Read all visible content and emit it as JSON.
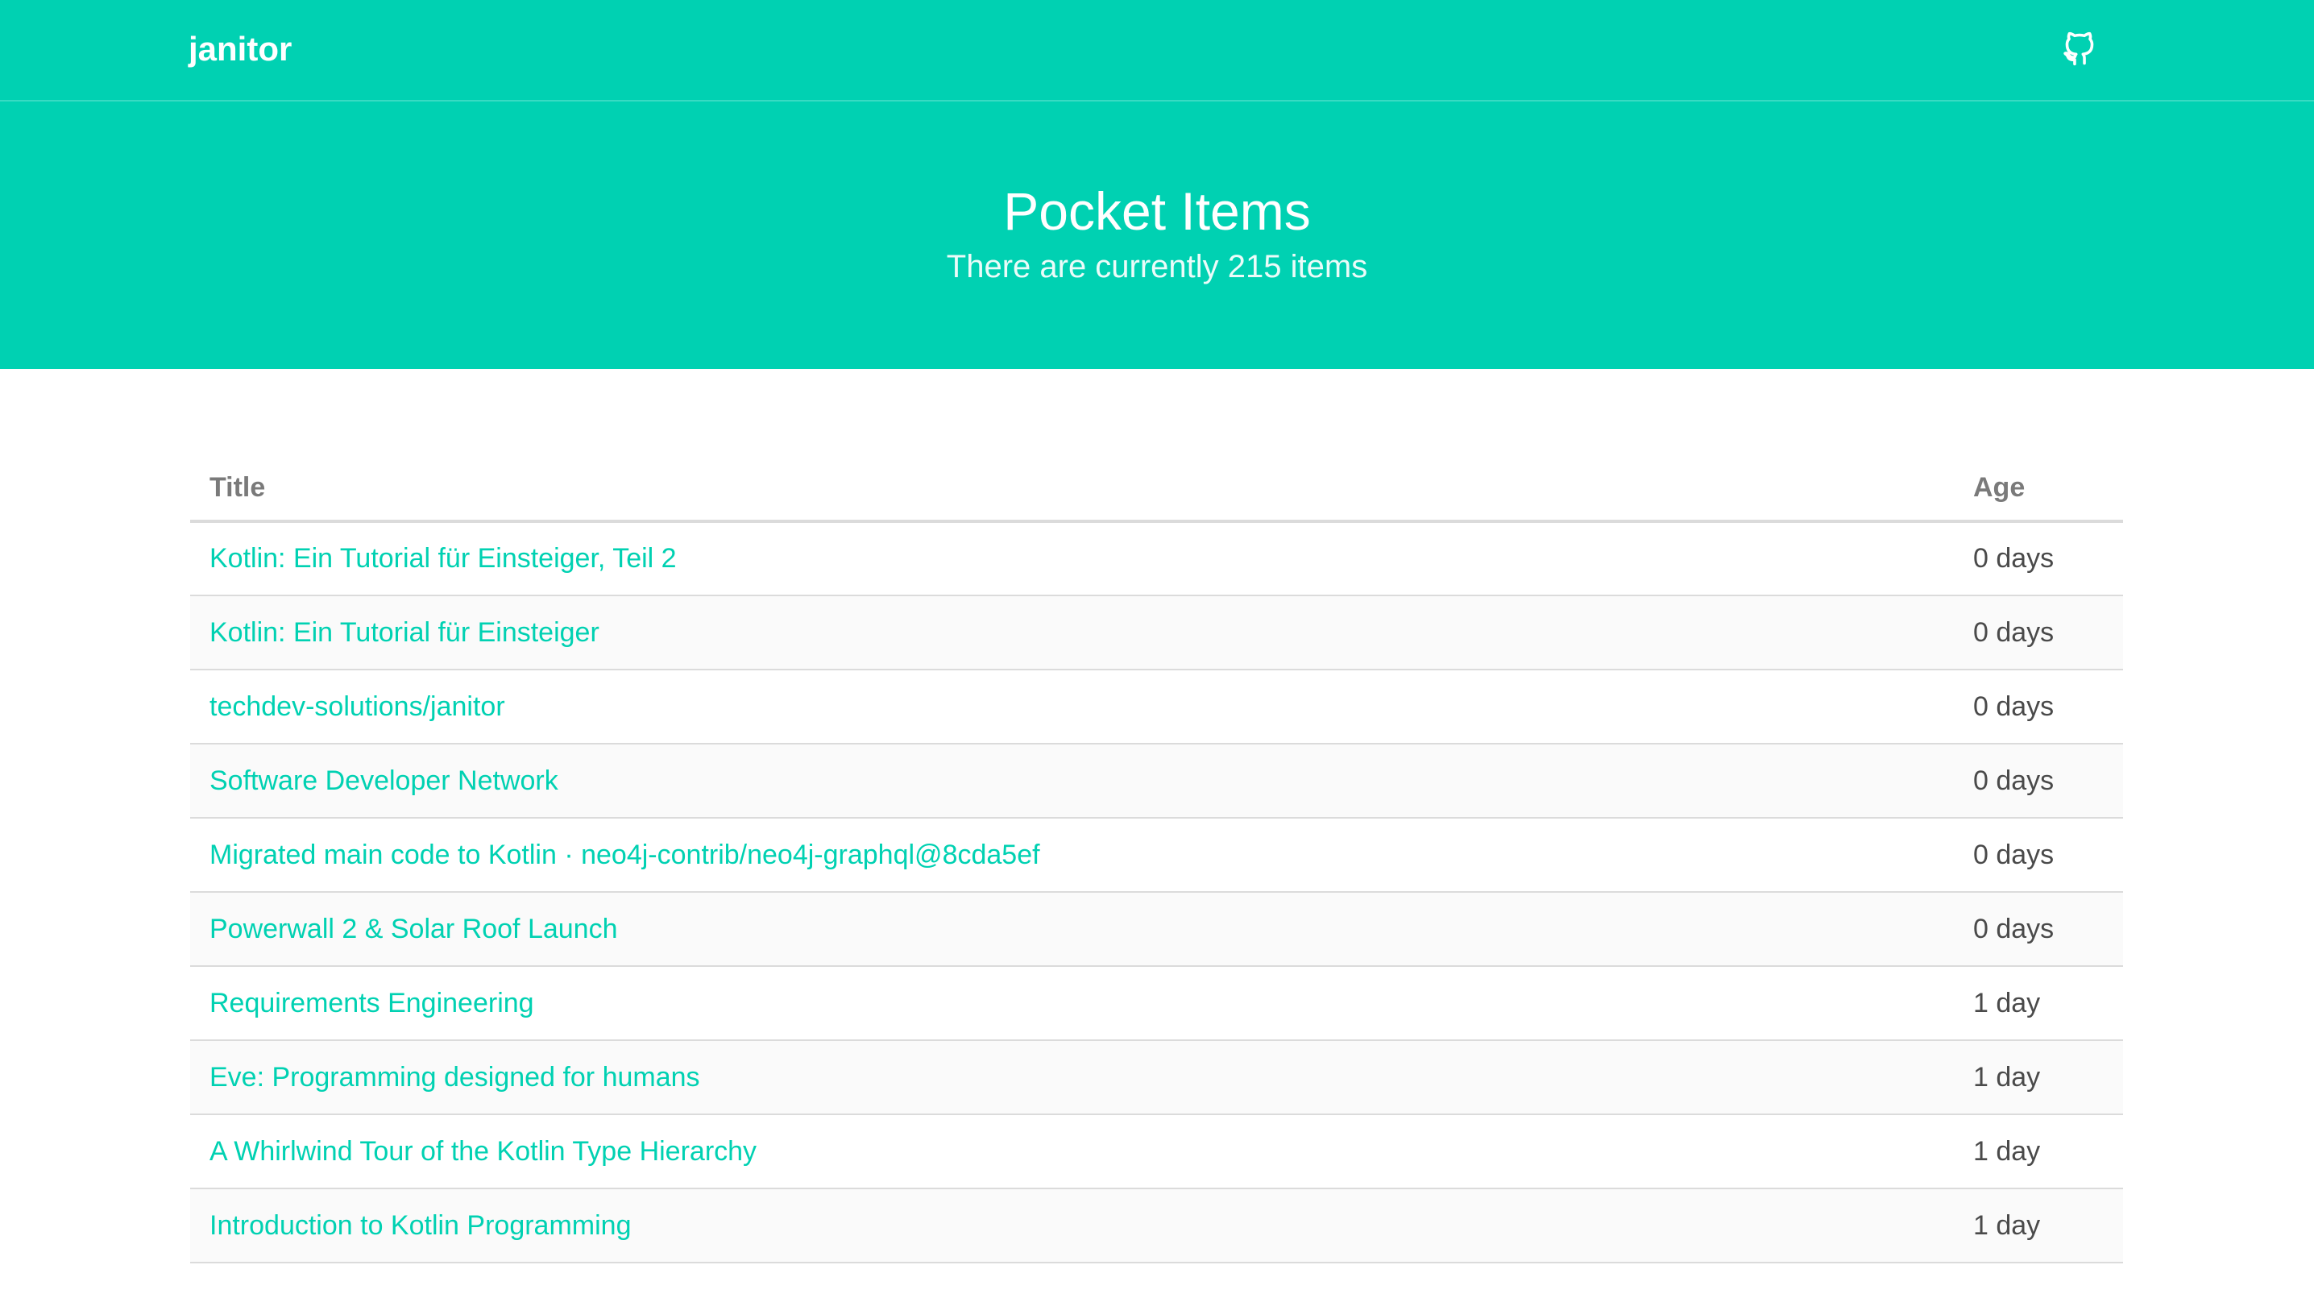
{
  "nav": {
    "brand": "janitor",
    "github_icon": "github-icon"
  },
  "hero": {
    "title": "Pocket Items",
    "subtitle": "There are currently 215 items"
  },
  "table": {
    "headers": {
      "title": "Title",
      "age": "Age"
    },
    "rows": [
      {
        "title": "Kotlin: Ein Tutorial für Einsteiger, Teil 2",
        "age": "0 days"
      },
      {
        "title": "Kotlin: Ein Tutorial für Einsteiger",
        "age": "0 days"
      },
      {
        "title": "techdev-solutions/janitor",
        "age": "0 days"
      },
      {
        "title": "Software Developer Network",
        "age": "0 days"
      },
      {
        "title": "Migrated main code to Kotlin · neo4j-contrib/neo4j-graphql@8cda5ef",
        "age": "0 days"
      },
      {
        "title": "Powerwall 2 & Solar Roof Launch",
        "age": "0 days"
      },
      {
        "title": "Requirements Engineering",
        "age": "1 day"
      },
      {
        "title": "Eve: Programming designed for humans",
        "age": "1 day"
      },
      {
        "title": "A Whirlwind Tour of the Kotlin Type Hierarchy",
        "age": "1 day"
      },
      {
        "title": "Introduction to Kotlin Programming",
        "age": "1 day"
      }
    ]
  },
  "colors": {
    "primary": "#00d1b2",
    "text": "#4a4a4a",
    "header_text": "#7a7a7a"
  }
}
